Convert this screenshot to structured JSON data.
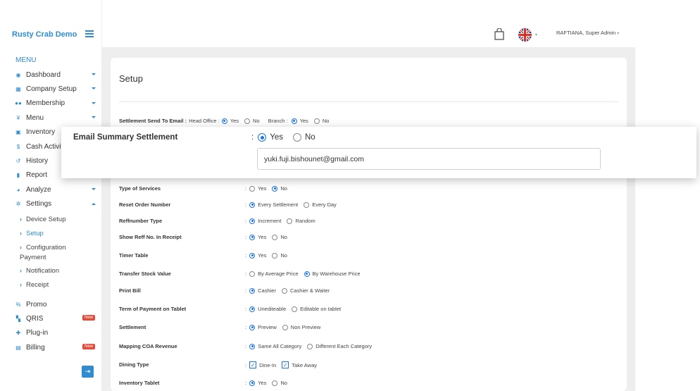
{
  "sidebar": {
    "brand": "Rusty Crab Demo",
    "menu_caption": "MENU",
    "items": [
      {
        "label": "Dashboard",
        "icon": "dashboard-icon",
        "caret": true
      },
      {
        "label": "Company Setup",
        "icon": "building-icon",
        "caret": true
      },
      {
        "label": "Membership",
        "icon": "users-icon",
        "caret": true
      },
      {
        "label": "Menu",
        "icon": "utensils-icon",
        "caret": true
      },
      {
        "label": "Inventory",
        "icon": "box-icon"
      },
      {
        "label": "Cash Activit",
        "icon": "dollar-icon"
      },
      {
        "label": "History",
        "icon": "history-icon"
      },
      {
        "label": "Report",
        "icon": "file-icon"
      },
      {
        "label": "Analyze",
        "icon": "chart-pie-icon",
        "caret": true
      },
      {
        "label": "Settings",
        "icon": "gear-icon",
        "caret": true
      }
    ],
    "settings_sub": [
      {
        "label": "Device Setup"
      },
      {
        "label": "Setup"
      },
      {
        "label": "Configuration",
        "label2": "Payment"
      },
      {
        "label": "Notification"
      },
      {
        "label": "Receipt"
      }
    ],
    "items2": [
      {
        "label": "Promo",
        "icon": "percent-icon"
      },
      {
        "label": "QRIS",
        "icon": "qr-icon",
        "badge": "New"
      },
      {
        "label": "Plug-in",
        "icon": "puzzle-icon"
      },
      {
        "label": "Billing",
        "icon": "billing-icon",
        "badge": "New"
      }
    ]
  },
  "header": {
    "user": "RAFTIANA, Super Admin"
  },
  "page": {
    "title": "Setup",
    "send": {
      "label": "Settlement Send To Email :",
      "head_office": "Head Office :",
      "branch": "Branch :",
      "yes": "Yes",
      "no": "No"
    },
    "rows": [
      {
        "label": "Type of Services",
        "options": [
          "Yes",
          "No"
        ]
      },
      {
        "label": "Reset Order Number",
        "options": [
          "Every Settlement",
          "Every Day"
        ]
      },
      {
        "label": "Reffnumber Type",
        "options": [
          "Increment",
          "Random"
        ]
      },
      {
        "label": "Show Reff No. In Receipt",
        "options": [
          "Yes",
          "No"
        ]
      },
      {
        "label": "Timer Table",
        "options": [
          "Yes",
          "No"
        ]
      },
      {
        "label": "Transfer Stock Value",
        "options": [
          "By Average Price",
          "By Warehouse Price"
        ]
      },
      {
        "label": "Print Bill",
        "options": [
          "Cashier",
          "Cashier & Waiter"
        ]
      },
      {
        "label": "Term of Payment on Tablet",
        "options": [
          "Unediteable",
          "Editable on tablet"
        ]
      },
      {
        "label": "Settlement",
        "options": [
          "Preview",
          "Non Preview"
        ]
      },
      {
        "label": "Mapping COA Revenue",
        "options": [
          "Same All Category",
          "Different Each Category"
        ]
      },
      {
        "label": "Dining Type",
        "options": [
          "Dine-In",
          "Take Away"
        ]
      },
      {
        "label": "Inventory Tablet",
        "options": [
          "Yes",
          "No"
        ]
      }
    ]
  },
  "zoom": {
    "label": "Email Summary Settlement",
    "yes": "Yes",
    "no": "No",
    "email_value": "yuki.fuji.bishounet@gmail.com"
  }
}
